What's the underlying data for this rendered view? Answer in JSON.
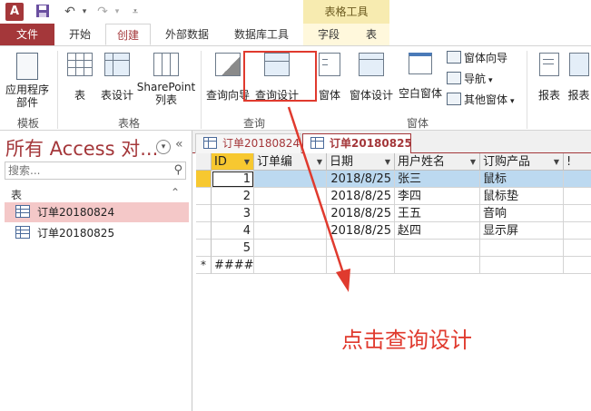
{
  "app": {
    "logo_text": "A",
    "context_group": "表格工具",
    "quick_access": [
      "save-icon",
      "undo-icon",
      "redo-icon",
      "customize-icon"
    ]
  },
  "ribbon_tabs": {
    "file": "文件",
    "home": "开始",
    "create": "创建",
    "external": "外部数据",
    "dbtools": "数据库工具",
    "fields": "字段",
    "table": "表"
  },
  "ribbon": {
    "templates": {
      "app_parts": "应用程序\n部件",
      "group": "模板"
    },
    "tables": {
      "table": "表",
      "table_design": "表设计",
      "sharepoint": "SharePoint\n列表",
      "group": "表格"
    },
    "queries": {
      "wizard": "查询向导",
      "design": "查询设计",
      "group": "查询"
    },
    "forms": {
      "form": "窗体",
      "form_design": "窗体设计",
      "blank_form": "空白窗体",
      "form_wizard": "窗体向导",
      "navigation": "导航",
      "more_forms": "其他窗体",
      "group": "窗体"
    },
    "reports": {
      "report": "报表",
      "report_more": "报表"
    }
  },
  "nav": {
    "title": "所有 Access 对...",
    "search_placeholder": "搜索...",
    "group": "表",
    "items": [
      "订单20180824",
      "订单20180825"
    ]
  },
  "doc_tabs": [
    "订单20180824",
    "订单20180825"
  ],
  "grid": {
    "columns": [
      "ID",
      "订单编",
      "日期",
      "用户姓名",
      "订购产品",
      "!"
    ],
    "rows": [
      {
        "id": "1",
        "date": "2018/8/25",
        "name": "张三",
        "product": "鼠标"
      },
      {
        "id": "2",
        "date": "2018/8/25",
        "name": "李四",
        "product": "鼠标垫"
      },
      {
        "id": "3",
        "date": "2018/8/25",
        "name": "王五",
        "product": "音响"
      },
      {
        "id": "4",
        "date": "2018/8/25",
        "name": "赵四",
        "product": "显示屏"
      },
      {
        "id": "5",
        "date": "",
        "name": "",
        "product": ""
      }
    ],
    "new_row_marker": "*",
    "new_row_id": "####"
  },
  "annotation": "点击查询设计",
  "colors": {
    "accent": "#a4373a",
    "highlight": "#e03a2e",
    "context": "#f7ebb0"
  }
}
